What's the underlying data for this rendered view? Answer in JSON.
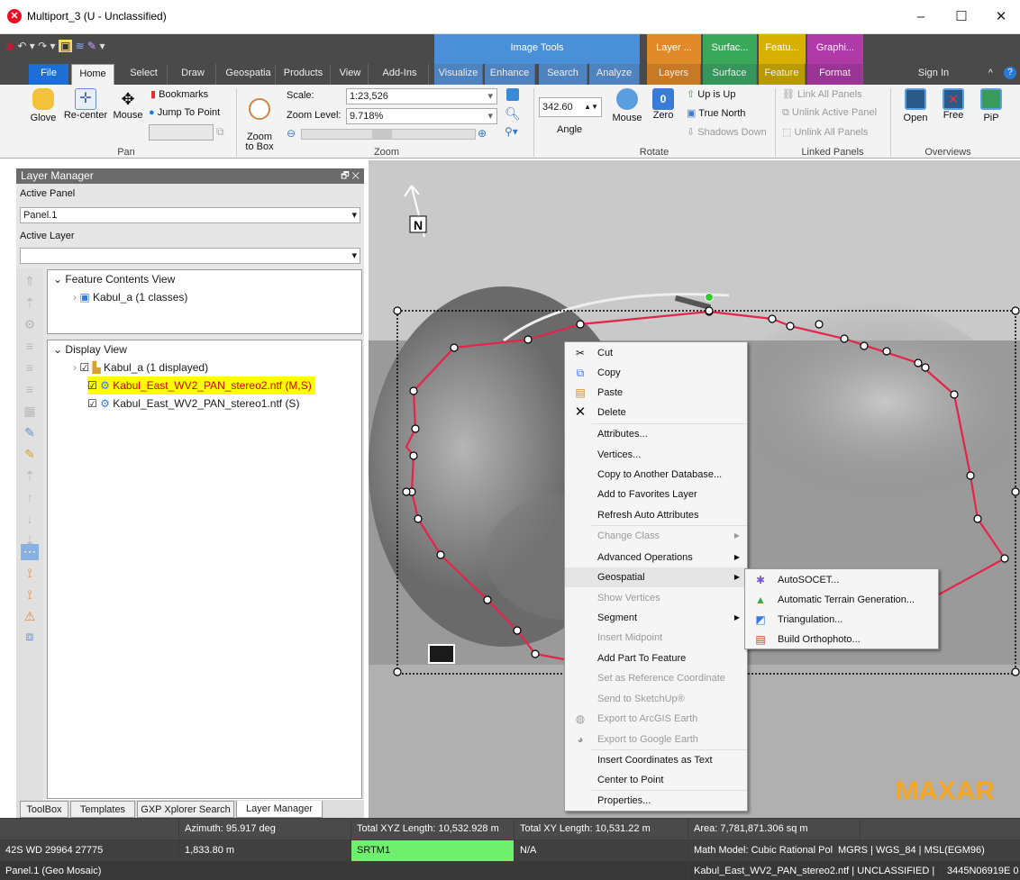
{
  "window": {
    "title": "Multiport_3 (U - Unclassified)",
    "minimize": "–",
    "maximize": "☐",
    "close": "✕"
  },
  "context_groups": [
    {
      "label": "Image Tools",
      "color": "#4a90d9"
    },
    {
      "label": "Layer ...",
      "color": "#e08a2a"
    },
    {
      "label": "Surfac...",
      "color": "#3aa85a"
    },
    {
      "label": "Featu...",
      "color": "#d8b000"
    },
    {
      "label": "Graphi...",
      "color": "#b03aa8"
    }
  ],
  "tabs": [
    "File",
    "Home",
    "Select",
    "Draw",
    "Geospatia",
    "Products",
    "View",
    "Add-Ins",
    "Visualize",
    "Enhance",
    "Search",
    "Analyze",
    "Layers",
    "Surface",
    "Feature",
    "Format"
  ],
  "sign_in": "Sign In",
  "ribbon": {
    "pan": {
      "glove": "Glove",
      "recenter": "Re-center",
      "mouse": "Mouse",
      "bookmarks": "Bookmarks",
      "jump": "Jump To Point",
      "label": "Pan"
    },
    "zoom": {
      "zoom_to_box": "Zoom\nto Box",
      "scale_label": "Scale:",
      "scale_value": "1:23,526",
      "zoom_level_label": "Zoom Level:",
      "zoom_level_value": "9.718%",
      "label": "Zoom"
    },
    "rotate": {
      "angle_value": "342.60",
      "angle": "Angle",
      "mouse": "Mouse",
      "zero": "Zero",
      "up_is_up": "Up is Up",
      "true_north": "True North",
      "shadows_down": "Shadows Down",
      "label": "Rotate"
    },
    "linked": {
      "link_all": "Link All Panels",
      "unlink_active": "Unlink Active Panel",
      "unlink_all": "Unlink All Panels",
      "label": "Linked Panels"
    },
    "overviews": {
      "open": "Open",
      "free": "Free",
      "pip": "PiP",
      "label": "Overviews"
    }
  },
  "layer_manager": {
    "title": "Layer Manager",
    "active_panel_label": "Active Panel",
    "active_panel_value": "Panel.1",
    "active_layer_label": "Active Layer",
    "active_layer_value": "",
    "feature_contents": "Feature Contents View",
    "feature_item": "Kabul_a  (1 classes)",
    "display_view": "Display View",
    "display_items": [
      "Kabul_a  (1 displayed)",
      "Kabul_East_WV2_PAN_stereo2.ntf (M,S)",
      "Kabul_East_WV2_PAN_stereo1.ntf (S)"
    ],
    "bottom_tabs": [
      "ToolBox",
      "Templates",
      "GXP Xplorer Search",
      "Layer Manager"
    ]
  },
  "context_menu": [
    {
      "label": "Cut",
      "icon": "scissors-icon",
      "glyph": "✂",
      "enabled": true
    },
    {
      "label": "Copy",
      "icon": "copy-icon",
      "glyph": "⧉",
      "enabled": true
    },
    {
      "label": "Paste",
      "icon": "paste-icon",
      "glyph": "📋",
      "enabled": true
    },
    {
      "label": "Delete",
      "icon": "delete-icon",
      "glyph": "✕",
      "enabled": true
    },
    {
      "label": "Attributes...",
      "enabled": true
    },
    {
      "label": "Vertices...",
      "enabled": true
    },
    {
      "label": "Copy to Another Database...",
      "enabled": true
    },
    {
      "label": "Add to Favorites Layer",
      "enabled": true
    },
    {
      "label": "Refresh Auto Attributes",
      "enabled": true
    },
    {
      "label": "Change Class",
      "enabled": false,
      "submenu": true
    },
    {
      "label": "Advanced Operations",
      "enabled": true,
      "submenu": true
    },
    {
      "label": "Geospatial",
      "enabled": true,
      "submenu": true
    },
    {
      "label": "Show Vertices",
      "enabled": false
    },
    {
      "label": "Segment",
      "enabled": true,
      "submenu": true
    },
    {
      "label": "Insert Midpoint",
      "enabled": false
    },
    {
      "label": "Add Part To Feature",
      "enabled": true
    },
    {
      "label": "Set as Reference Coordinate",
      "enabled": false
    },
    {
      "label": "Send to SketchUp®",
      "enabled": false
    },
    {
      "label": "Export to ArcGIS Earth",
      "enabled": false
    },
    {
      "label": "Export to Google Earth",
      "enabled": false
    },
    {
      "label": "Insert Coordinates as Text",
      "enabled": true
    },
    {
      "label": "Center to Point",
      "enabled": true
    },
    {
      "label": "Properties...",
      "enabled": true
    }
  ],
  "submenu": [
    "AutoSOCET...",
    "Automatic Terrain Generation...",
    "Triangulation...",
    "Build Orthophoto..."
  ],
  "map": {
    "north": "N",
    "logo": "MAXAR"
  },
  "status": {
    "azimuth": "Azimuth: 95.917 deg",
    "total_xyz": "Total XYZ Length: 10,532.928 m",
    "total_xy": "Total XY Length: 10,531.22 m",
    "area": "Area: 7,781,871.306 sq m",
    "coord": "42S WD 29964 27775",
    "elev": "1,833.80 m",
    "dem": "SRTM1",
    "na": "N/A",
    "math_model": "Math Model: Cubic Rational Polynomia",
    "datum": "MGRS | WGS_84 | MSL(EGM96)",
    "panel": "Panel.1 (Geo Mosaic)",
    "image_info": "Kabul_East_WV2_PAN_stereo2.ntf | UNCLASSIFIED |",
    "image_id": "3445N06919E 0"
  }
}
